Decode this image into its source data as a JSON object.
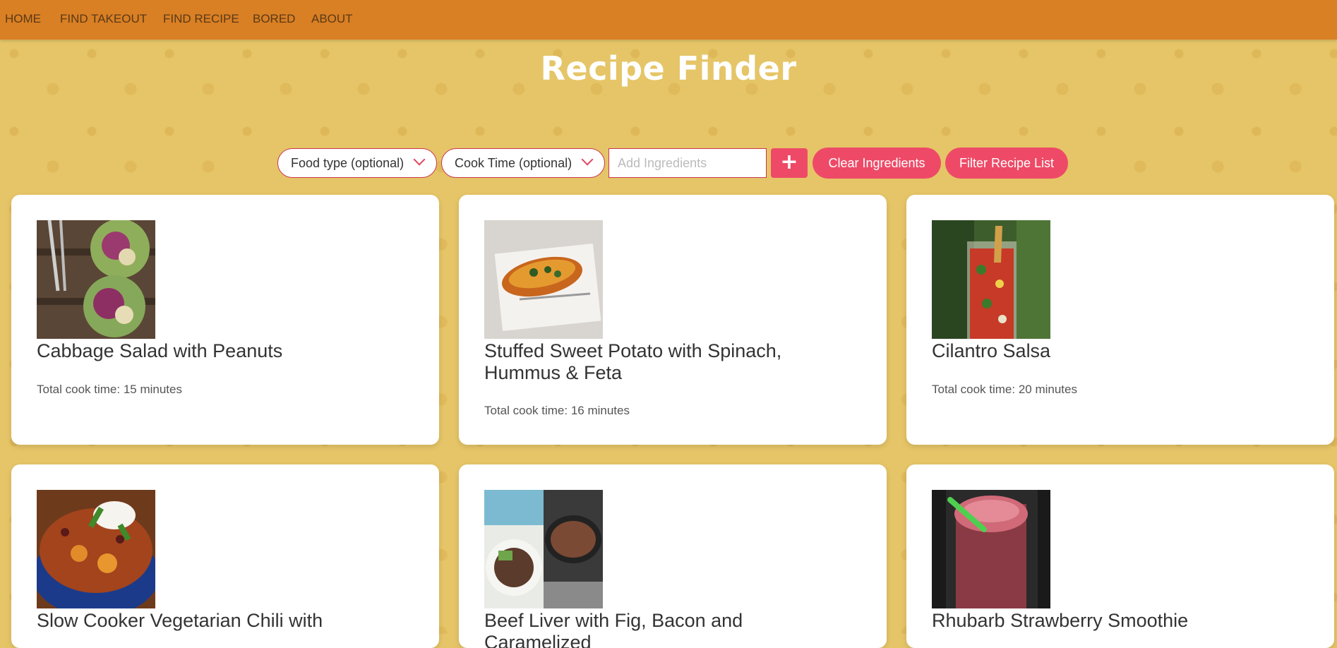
{
  "nav": {
    "items": [
      "HOME",
      "FIND TAKEOUT",
      "FIND RECIPE",
      "BORED",
      "ABOUT"
    ]
  },
  "header": {
    "title": "Recipe Finder"
  },
  "filters": {
    "food_type": "Food type (optional)",
    "cook_time": "Cook Time (optional)",
    "ingredients_placeholder": "Add Ingredients",
    "add_label": "+",
    "clear_label": "Clear Ingredients",
    "filter_label": "Filter Recipe List"
  },
  "recipes": [
    {
      "title": "Cabbage Salad with Peanuts",
      "time": "Total cook time: 15 minutes"
    },
    {
      "title": "Stuffed Sweet Potato with Spinach, Hummus & Feta",
      "time": "Total cook time: 16 minutes"
    },
    {
      "title": "Cilantro Salsa",
      "time": "Total cook time: 20 minutes"
    },
    {
      "title": "Slow Cooker Vegetarian Chili with",
      "time": ""
    },
    {
      "title": "Beef Liver with Fig, Bacon and Caramelized",
      "time": ""
    },
    {
      "title": "Rhubarb Strawberry Smoothie",
      "time": ""
    }
  ],
  "colors": {
    "nav": "#d97f24",
    "background": "#e5c567",
    "accent": "#ee4a67"
  }
}
